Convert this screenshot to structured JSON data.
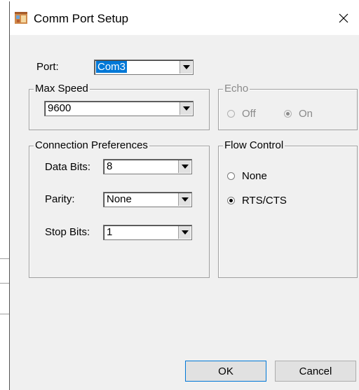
{
  "window": {
    "title": "Comm Port Setup",
    "close_glyph": "✕"
  },
  "port": {
    "label": "Port:",
    "value": "Com3"
  },
  "max_speed": {
    "group_label": "Max Speed",
    "value": "9600"
  },
  "echo": {
    "group_label": "Echo",
    "options": [
      {
        "label": "Off",
        "selected": false
      },
      {
        "label": "On",
        "selected": true
      }
    ],
    "enabled": false
  },
  "connection_preferences": {
    "group_label": "Connection Preferences",
    "data_bits": {
      "label": "Data Bits:",
      "value": "8"
    },
    "parity": {
      "label": "Parity:",
      "value": "None"
    },
    "stop_bits": {
      "label": "Stop Bits:",
      "value": "1"
    }
  },
  "flow_control": {
    "group_label": "Flow Control",
    "options": [
      {
        "label": "None",
        "selected": false
      },
      {
        "label": "RTS/CTS",
        "selected": true
      }
    ]
  },
  "buttons": {
    "ok": "OK",
    "cancel": "Cancel"
  },
  "icons": {
    "title": "app-window-icon",
    "close": "close-icon",
    "dropdown": "chevron-down-icon"
  }
}
